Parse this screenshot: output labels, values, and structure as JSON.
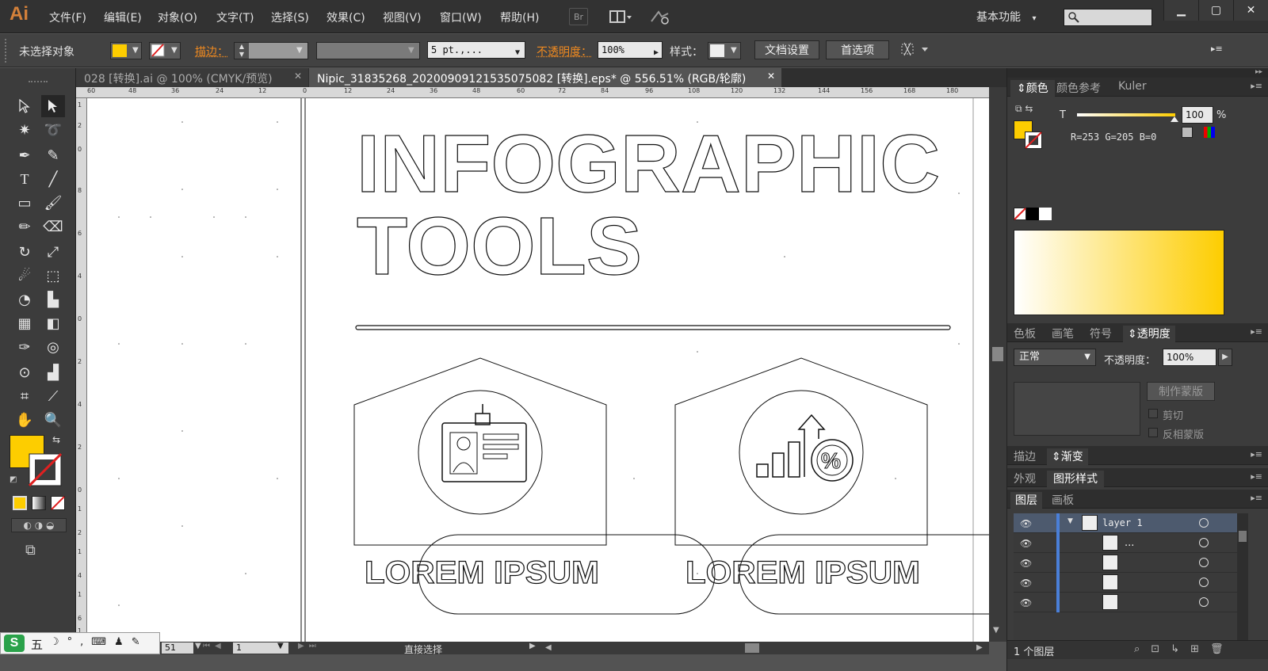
{
  "app": {
    "logo": "Ai",
    "menus": [
      "文件(F)",
      "编辑(E)",
      "对象(O)",
      "文字(T)",
      "选择(S)",
      "效果(C)",
      "视图(V)",
      "窗口(W)",
      "帮助(H)"
    ],
    "bridge_label": "Br",
    "workspace": "基本功能",
    "accent": "#d4813a"
  },
  "controlbar": {
    "selection_status": "未选择对象",
    "fill_color": "#fdcd00",
    "stroke_label": "描边：",
    "brush_value": "5 pt.,...",
    "opacity_label": "不透明度：",
    "opacity_value": "100%",
    "style_label": "样式：",
    "doc_setup": "文档设置",
    "preferences": "首选项"
  },
  "tabs": [
    {
      "title": "028 [转换].ai @ 100% (CMYK/预览)",
      "active": false
    },
    {
      "title": "Nipic_31835268_20200909121535075082 [转换].eps* @ 556.51% (RGB/轮廓)",
      "active": true
    }
  ],
  "ruler": {
    "top": [
      "60",
      "48",
      "36",
      "24",
      "12",
      "0",
      "12",
      "24",
      "36",
      "48",
      "60",
      "72",
      "84",
      "96",
      "108",
      "120",
      "132",
      "144",
      "156",
      "168",
      "180"
    ],
    "left": [
      "1",
      "2",
      "0",
      "8",
      "6",
      "4",
      "0",
      "2",
      "4",
      "2",
      "0",
      "1",
      "2",
      "1",
      "4",
      "1",
      "6",
      "1",
      "8"
    ]
  },
  "artwork": {
    "title_line1": "INFOGRAPHIC",
    "title_line2": "TOOLS",
    "card1_label": "LOREM IPSUM",
    "card2_label": "LOREM IPSUM",
    "percent_symbol": "%"
  },
  "status": {
    "zoom": "51",
    "artboard": "1",
    "tool": "直接选择"
  },
  "color_panel": {
    "tabs": [
      "颜色",
      "颜色参考",
      "Kuler"
    ],
    "channel": "T",
    "value": "100",
    "unit": "%",
    "rgb_readout": "R=253 G=205 B=0",
    "color": "#fdcd00"
  },
  "transparency_panel": {
    "tabs": [
      "色板",
      "画笔",
      "符号",
      "透明度"
    ],
    "blend_mode": "正常",
    "opacity_label": "不透明度：",
    "opacity_value": "100%",
    "make_mask": "制作蒙版",
    "clip": "剪切",
    "invert_mask": "反相蒙版"
  },
  "stroke_gradient": {
    "tabs": [
      "描边",
      "渐变"
    ]
  },
  "appearance": {
    "tabs": [
      "外观",
      "图形样式"
    ]
  },
  "layers": {
    "tabs": [
      "图层",
      "画板"
    ],
    "rows": [
      "layer 1",
      "...",
      "",
      "",
      ""
    ],
    "count": "1 个图层"
  },
  "ime": {
    "mode": "五"
  }
}
